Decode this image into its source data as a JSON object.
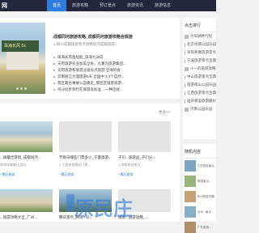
{
  "header": {
    "logo": "网",
    "nav": [
      "首页",
      "旅游攻略",
      "预订景点",
      "旅游资讯",
      "旅游信息"
    ]
  },
  "main": {
    "slider_caption": "珠海长风 Sc",
    "headline": "成都同河旅游攻略_成都同河旅游攻略合规游",
    "subline": "1.四川成都旅游景点攻略同河成都旅游...",
    "news": [
      "珠海长风渔船船_珠海九洲岛",
      "天府旅游农业加美全省，九寨沟旅游集团...",
      "天府旅游和旅游业观光点旅游 全球的各",
      "云南丽江大理旅游5天 全国中 3 3个自然...",
      "景区最古事故公自路走_景区区域景观游...",
      "丹沙同步到行在旅游高标准 ...一种连接..."
    ]
  },
  "sidebar_top": {
    "title": "点击排行",
    "items": [
      "大阳湖畔行程",
      "北京周期公园乐园",
      "深圳养康旅游景点",
      "宁波旅游景点宝典",
      "十一的旅游攻略",
      "中山旅游景点宝典",
      "旅游南山公园乐园",
      "江西旅游景点宝典",
      "国庆哪里旅游最好",
      "济南公园乐园"
    ]
  },
  "section": {
    "more": "更多>>",
    "cards": [
      {
        "title": "...阔最佳游玩_成都同河...",
        "desc": "旅游攻略最佳游玩...",
        "tag": "+景区旅游"
      },
      {
        "title": "节假日哪些门票多少_宁夏旅游...",
        "desc": "1.宁夏旅游景区门票...",
        "tag": "+景区旅游"
      },
      {
        "title": "子们...旅游品_子们分...",
        "desc": "1.成都旅游景点...",
        "tag": "+景区旅游"
      },
      {
        "title": "景区最石事故公路_景石石地",
        "desc": "1.景区景石观众...",
        "tag": "+景区旅游"
      }
    ],
    "bottom": [
      "...旅游攻略大全_广州...",
      "腾讯景点_腾讯...分...",
      "闽南...旅游攻略_...",
      "台州旅游景点大全_台州..."
    ]
  },
  "sidebar_bottom": {
    "title": "随机内容",
    "items": [
      "江苏旅游景点...",
      "泰国景点...",
      "杭州旅游攻略...",
      "台州...景点...",
      "广东旅游..."
    ]
  },
  "watermark": "原民庄"
}
